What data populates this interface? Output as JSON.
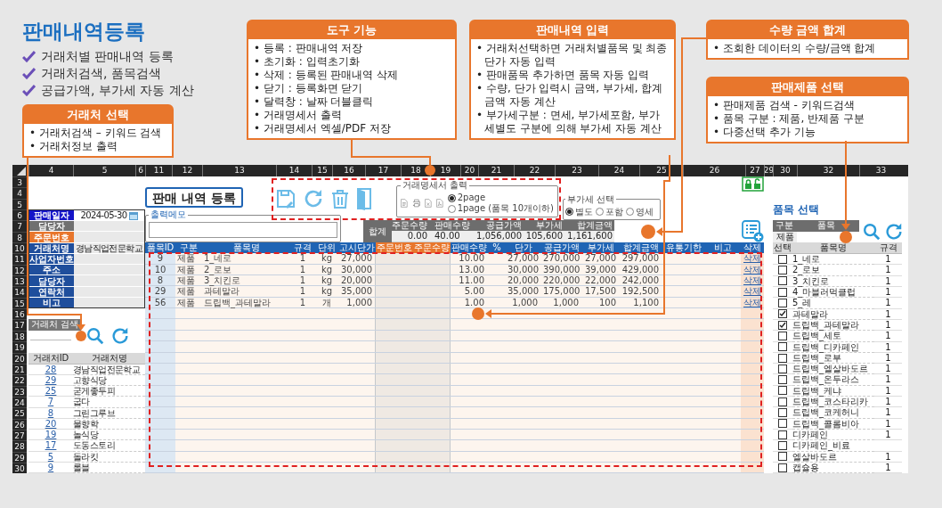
{
  "page_title": "판매내역등록",
  "features": [
    "거래처별 판매내역 등록",
    "거래처검색, 품목검색",
    "공급가액, 부가세 자동 계산"
  ],
  "callouts": [
    {
      "title": "거래처 선택",
      "items": [
        "• 거래처검색 – 키워드 검색",
        "• 거래처정보 출력"
      ]
    },
    {
      "title": "도구 기능",
      "items": [
        "• 등록 : 판매내역 저장",
        "• 초기화 : 입력초기화",
        "• 삭제 : 등록된 판매내역 삭제",
        "• 닫기 : 등록화면 닫기",
        "• 달력창 : 날짜 더블클릭",
        "• 거래명세서 출력",
        "• 거래명세서 엑셀/PDF 저장"
      ]
    },
    {
      "title": "판매내역 입력",
      "items": [
        "• 거래처선택하면 거래처별품목 및 최종 단가 자동 입력",
        "• 판매품목 추가하면 품목 자동 입력",
        "• 수량, 단가 입력시 금액, 부가세, 합계금액 자동 계산",
        "• 부가세구분 : 면세, 부가세포함, 부가세별도 구분에 의해 부가세 자동 계산"
      ]
    },
    {
      "title": "수량 금액 합계",
      "items": [
        "• 조회한 데이터의 수량/금액 합계"
      ]
    },
    {
      "title": "판매제품 선택",
      "items": [
        "• 판매제품 검색 - 키워드검색",
        "• 품목 구분 : 제품, 반제품 구분",
        "• 다중선택 추가 기능"
      ]
    }
  ],
  "sheet": {
    "column_headers": [
      "4",
      "5",
      "6",
      "11",
      "12",
      "13",
      "14",
      "15",
      "16",
      "17",
      "18",
      "19",
      "20",
      "21",
      "22",
      "23",
      "24",
      "25",
      "26",
      "27",
      "29",
      "30",
      "32",
      "33"
    ],
    "row_numbers": [
      "3",
      "4",
      "5",
      "6",
      "7",
      "8",
      "10",
      "11",
      "12",
      "13",
      "14",
      "15",
      "16",
      "17",
      "18",
      "19",
      "20",
      "21",
      "22",
      "23",
      "24",
      "25",
      "26",
      "27",
      "28",
      "29",
      "30"
    ]
  },
  "client_form": [
    {
      "label": "판매일자",
      "color": "#1414c8",
      "kind": "date",
      "value": "2024-05-30"
    },
    {
      "label": "담당자",
      "color": "#707070",
      "kind": "text"
    },
    {
      "label": "주문번호",
      "color": "#e8762c",
      "kind": "text"
    },
    {
      "label": "거래처명",
      "color": "#1f4e9c",
      "kind": "text",
      "value": "경남직업전문학교"
    },
    {
      "label": "사업자번호",
      "color": "#1f4e9c",
      "kind": "text"
    },
    {
      "label": "주소",
      "color": "#1f4e9c",
      "kind": "text"
    },
    {
      "label": "담당자",
      "color": "#1f4e9c",
      "kind": "text"
    },
    {
      "label": "연락처",
      "color": "#1f4e9c",
      "kind": "text"
    },
    {
      "label": "비고",
      "color": "#1f4e9c",
      "kind": "text"
    }
  ],
  "client_search": {
    "label": "거래처 검색",
    "columns": [
      "거래처ID",
      "거래처명"
    ],
    "rows": [
      {
        "id": "28",
        "name": "경남직업전문학교"
      },
      {
        "id": "29",
        "name": "고향식당"
      },
      {
        "id": "25",
        "name": "굳게좋두피"
      },
      {
        "id": "7",
        "name": "굽다"
      },
      {
        "id": "8",
        "name": "그린그루브"
      },
      {
        "id": "20",
        "name": "물향학"
      },
      {
        "id": "19",
        "name": "놀식당"
      },
      {
        "id": "17",
        "name": "도동스토리"
      },
      {
        "id": "5",
        "name": "돌라킷"
      },
      {
        "id": "9",
        "name": "롤블"
      }
    ]
  },
  "sales": {
    "title": "판매 내역 등록",
    "memo_label": "출력메모",
    "statement_output": {
      "label": "거래명세서 출력",
      "options": [
        {
          "label": "2page",
          "selected": true
        },
        {
          "label": "1page (품목 10개이하)",
          "selected": false
        }
      ]
    },
    "vat_select": {
      "label": "부가세 선택",
      "options": [
        {
          "label": "별도",
          "selected": true
        },
        {
          "label": "포함",
          "selected": false
        },
        {
          "label": "영세",
          "selected": false
        }
      ]
    },
    "totals": {
      "label": "합계",
      "columns": [
        {
          "header": "주문수량",
          "value": "0.00"
        },
        {
          "header": "판매수량",
          "value": "40.00"
        },
        {
          "header": "공급가액",
          "value": "1,056,000"
        },
        {
          "header": "부가세",
          "value": "105,600"
        },
        {
          "header": "합계금액",
          "value": "1,161,600"
        }
      ]
    },
    "table": {
      "columns": [
        {
          "label": "품목ID",
          "color": "#1f64b4"
        },
        {
          "label": "구분",
          "color": "#1f64b4"
        },
        {
          "label": "품목명",
          "color": "#1f64b4"
        },
        {
          "label": "규격",
          "color": "#1f64b4"
        },
        {
          "label": "단위",
          "color": "#1f64b4"
        },
        {
          "label": "고시단가",
          "color": "#1f64b4"
        },
        {
          "label": "주문번호",
          "color": "#e8762c"
        },
        {
          "label": "주문수량",
          "color": "#e8762c"
        },
        {
          "label": "판매수량",
          "color": "#1f64b4"
        },
        {
          "label": "%",
          "color": "#1f64b4"
        },
        {
          "label": "단가",
          "color": "#1f64b4"
        },
        {
          "label": "공급가액",
          "color": "#1f64b4"
        },
        {
          "label": "부가세",
          "color": "#1f64b4"
        },
        {
          "label": "합계금액",
          "color": "#1f64b4"
        },
        {
          "label": "유통기한",
          "color": "#1f64b4"
        },
        {
          "label": "비고",
          "color": "#1f64b4"
        },
        {
          "label": "삭제",
          "color": "#1f64b4"
        }
      ],
      "rows": [
        {
          "id": "9",
          "type": "제품",
          "name": "1_네로",
          "spec": "1",
          "unit": "kg",
          "list_price": "27,000",
          "sale_qty": "10.00",
          "price": "27,000",
          "supply": "270,000",
          "vat": "27,000",
          "total": "297,000",
          "action": "삭제"
        },
        {
          "id": "10",
          "type": "제품",
          "name": "2_로보",
          "spec": "1",
          "unit": "kg",
          "list_price": "30,000",
          "sale_qty": "13.00",
          "price": "30,000",
          "supply": "390,000",
          "vat": "39,000",
          "total": "429,000",
          "action": "삭제"
        },
        {
          "id": "8",
          "type": "제품",
          "name": "3_치킨로",
          "spec": "1",
          "unit": "kg",
          "list_price": "20,000",
          "sale_qty": "11.00",
          "price": "20,000",
          "supply": "220,000",
          "vat": "22,000",
          "total": "242,000",
          "action": "삭제"
        },
        {
          "id": "29",
          "type": "제품",
          "name": "과테말라",
          "spec": "1",
          "unit": "kg",
          "list_price": "35,000",
          "sale_qty": "5.00",
          "price": "35,000",
          "supply": "175,000",
          "vat": "17,500",
          "total": "192,500",
          "action": "삭제"
        },
        {
          "id": "56",
          "type": "제품",
          "name": "드립백_과테말라",
          "spec": "1",
          "unit": "개",
          "list_price": "1,000",
          "sale_qty": "1.00",
          "price": "1,000",
          "supply": "1,000",
          "vat": "100",
          "total": "1,100",
          "action": "삭제"
        }
      ]
    }
  },
  "product_select": {
    "title": "품목 선택",
    "filter_headers": [
      "구분",
      "품목"
    ],
    "category": "제품",
    "columns": [
      "선택",
      "품목명",
      "규격"
    ],
    "rows": [
      {
        "name": "1_네로",
        "spec": "1",
        "checked": false
      },
      {
        "name": "2_로보",
        "spec": "1",
        "checked": false
      },
      {
        "name": "3_치킨로",
        "spec": "1",
        "checked": false
      },
      {
        "name": "4_마블러먹클럽",
        "spec": "1",
        "checked": false
      },
      {
        "name": "5_레",
        "spec": "1",
        "checked": false
      },
      {
        "name": "과테말라",
        "spec": "1",
        "checked": true
      },
      {
        "name": "드립백_과테말라",
        "spec": "1",
        "checked": true
      },
      {
        "name": "드립백_세토",
        "spec": "1",
        "checked": false
      },
      {
        "name": "드립백_디카페인",
        "spec": "1",
        "checked": false
      },
      {
        "name": "드립백_로부",
        "spec": "1",
        "checked": false
      },
      {
        "name": "드립백_엘살바도르",
        "spec": "1",
        "checked": false
      },
      {
        "name": "드립백_온두라스",
        "spec": "1",
        "checked": false
      },
      {
        "name": "드립백_케냐",
        "spec": "1",
        "checked": false
      },
      {
        "name": "드립백_코스타리카",
        "spec": "1",
        "checked": false
      },
      {
        "name": "드립백_코케허니",
        "spec": "1",
        "checked": false
      },
      {
        "name": "드립백_콜롬비아",
        "spec": "1",
        "checked": false
      },
      {
        "name": "디카페인",
        "spec": "1",
        "checked": false
      },
      {
        "name": "디카페인_비료",
        "checked": false
      },
      {
        "name": "엘살바도르",
        "spec": "1",
        "checked": false
      },
      {
        "name": "캡슐용",
        "spec": "1",
        "checked": false
      }
    ]
  }
}
